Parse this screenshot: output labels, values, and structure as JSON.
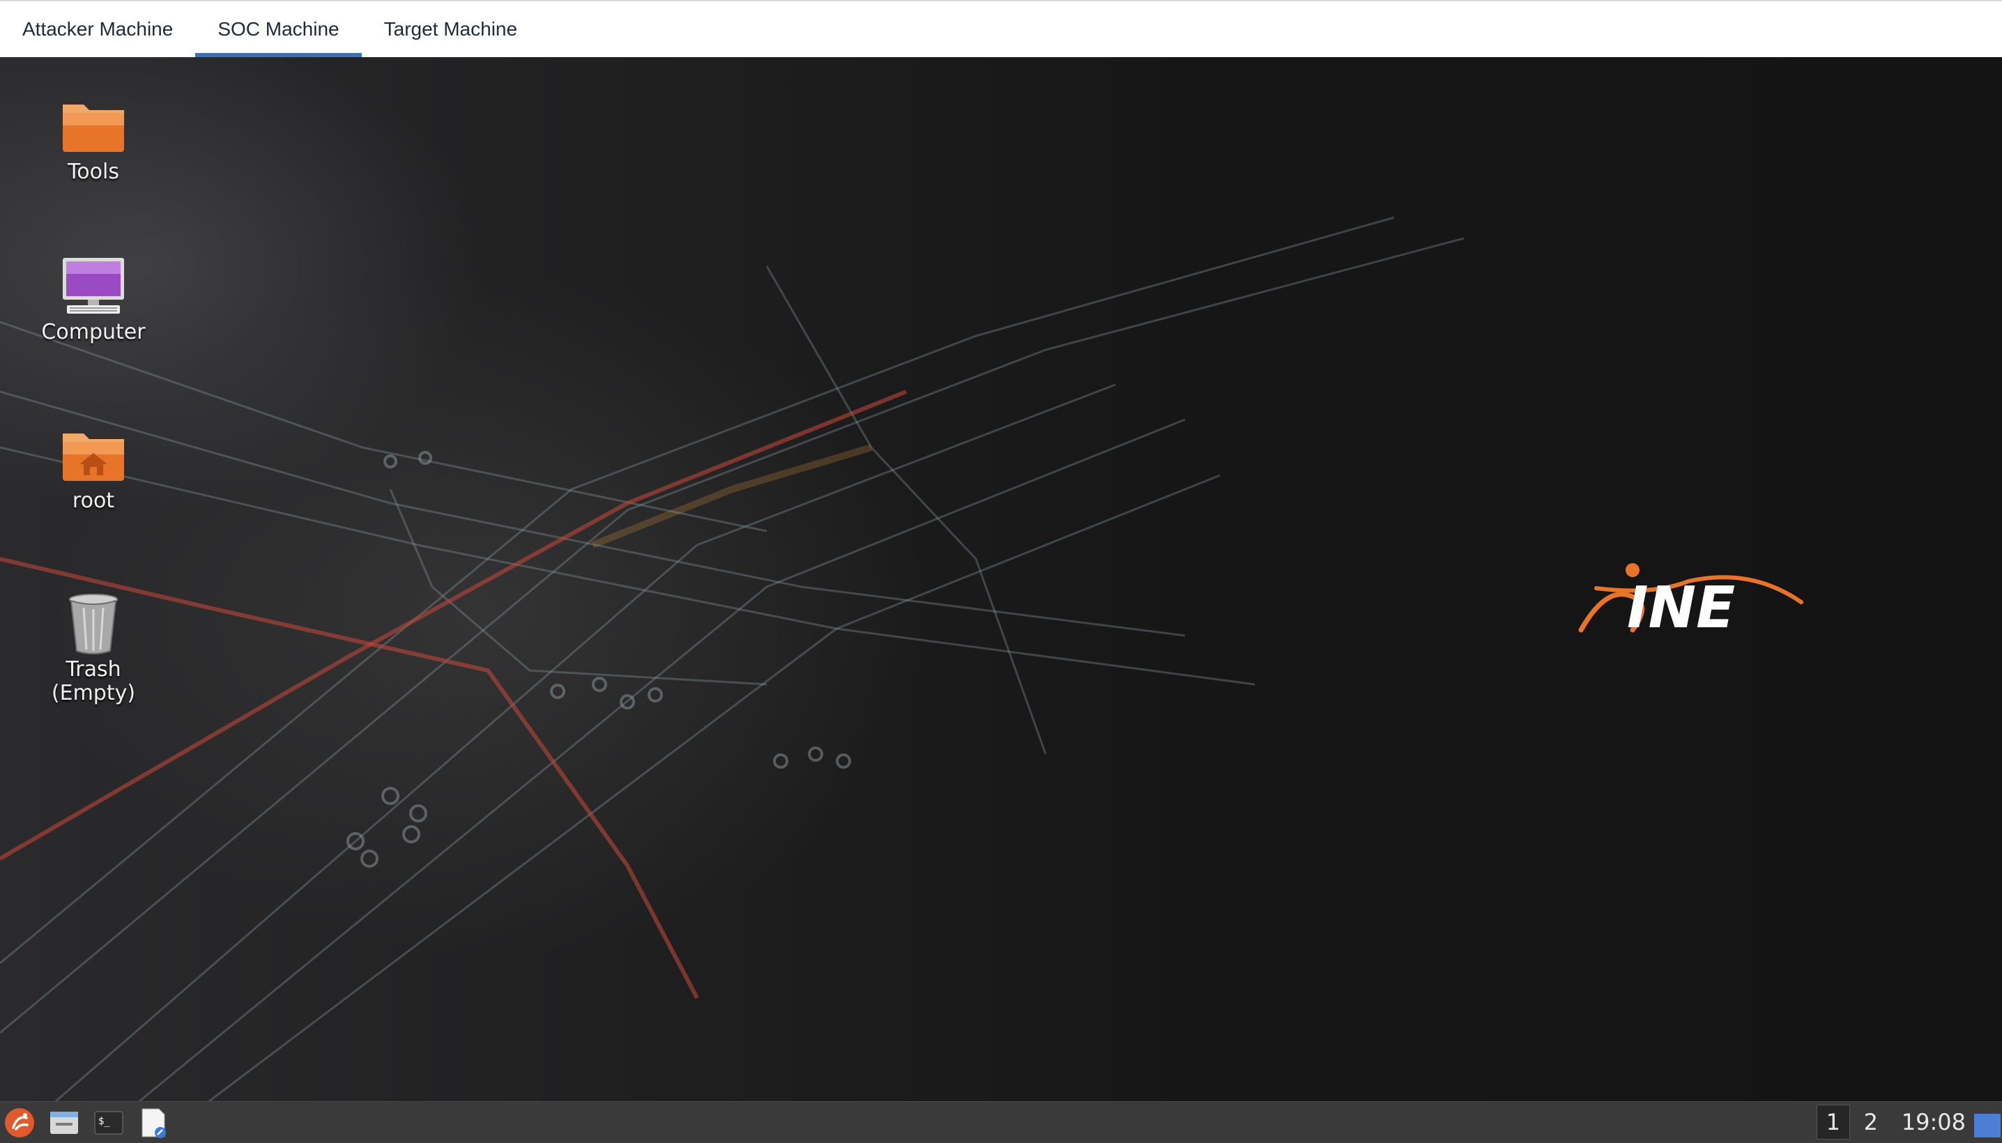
{
  "tabs": [
    {
      "label": "Attacker Machine",
      "active": false
    },
    {
      "label": "SOC Machine",
      "active": true
    },
    {
      "label": "Target Machine",
      "active": false
    }
  ],
  "desktop": {
    "icons": [
      {
        "label": "Tools",
        "icon": "folder-icon"
      },
      {
        "label": "Computer",
        "icon": "computer-icon"
      },
      {
        "label": "root",
        "icon": "home-folder-icon"
      },
      {
        "label": "Trash\n(Empty)",
        "icon": "trash-icon"
      }
    ],
    "logo_text": "INE"
  },
  "taskbar": {
    "launchers": [
      "app-menu-icon",
      "file-manager-icon",
      "terminal-icon",
      "text-editor-icon"
    ],
    "workspaces": [
      "1",
      "2"
    ],
    "clock": "19:08"
  },
  "colors": {
    "tab_active_underline": "#3e6fb8",
    "brand_orange": "#e8742a",
    "taskbar_bg": "#3a3a3a",
    "show_desktop": "#4a7fd4"
  }
}
